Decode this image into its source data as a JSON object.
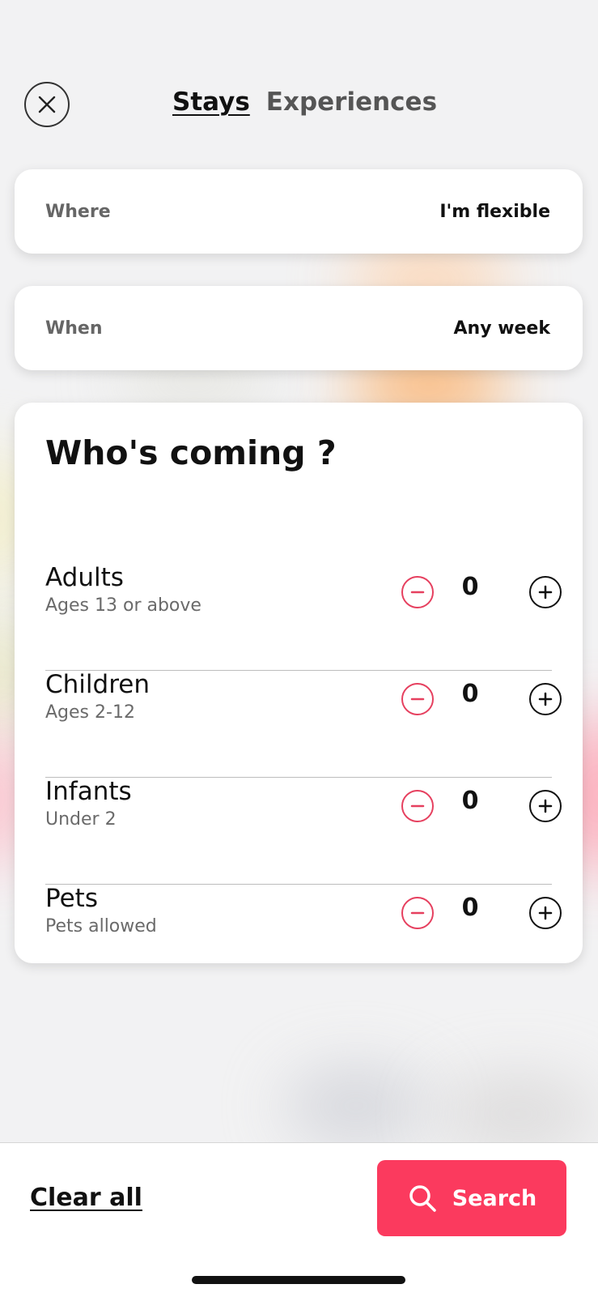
{
  "status_bar": {
    "time": ""
  },
  "header": {
    "tabs": [
      {
        "label": "Stays",
        "active": true
      },
      {
        "label": "Experiences",
        "active": false
      }
    ]
  },
  "where": {
    "label": "Where",
    "value": "I'm flexible"
  },
  "when": {
    "label": "When",
    "value": "Any week"
  },
  "guests": {
    "title": "Who's coming ?",
    "rows": [
      {
        "name": "Adults",
        "sub": "Ages 13 or above",
        "count": "0"
      },
      {
        "name": "Children",
        "sub": "Ages 2-12",
        "count": "0"
      },
      {
        "name": "Infants",
        "sub": "Under 2",
        "count": "0"
      },
      {
        "name": "Pets",
        "sub": "Pets allowed",
        "count": "0"
      }
    ]
  },
  "footer": {
    "clear_label": "Clear all",
    "search_label": "Search"
  },
  "colors": {
    "accent": "#fb3a5e",
    "minus": "#e6405f",
    "text": "#111111"
  },
  "icons": {
    "close": "close-icon",
    "minus": "minus-icon",
    "plus": "plus-icon",
    "search": "search-icon"
  }
}
